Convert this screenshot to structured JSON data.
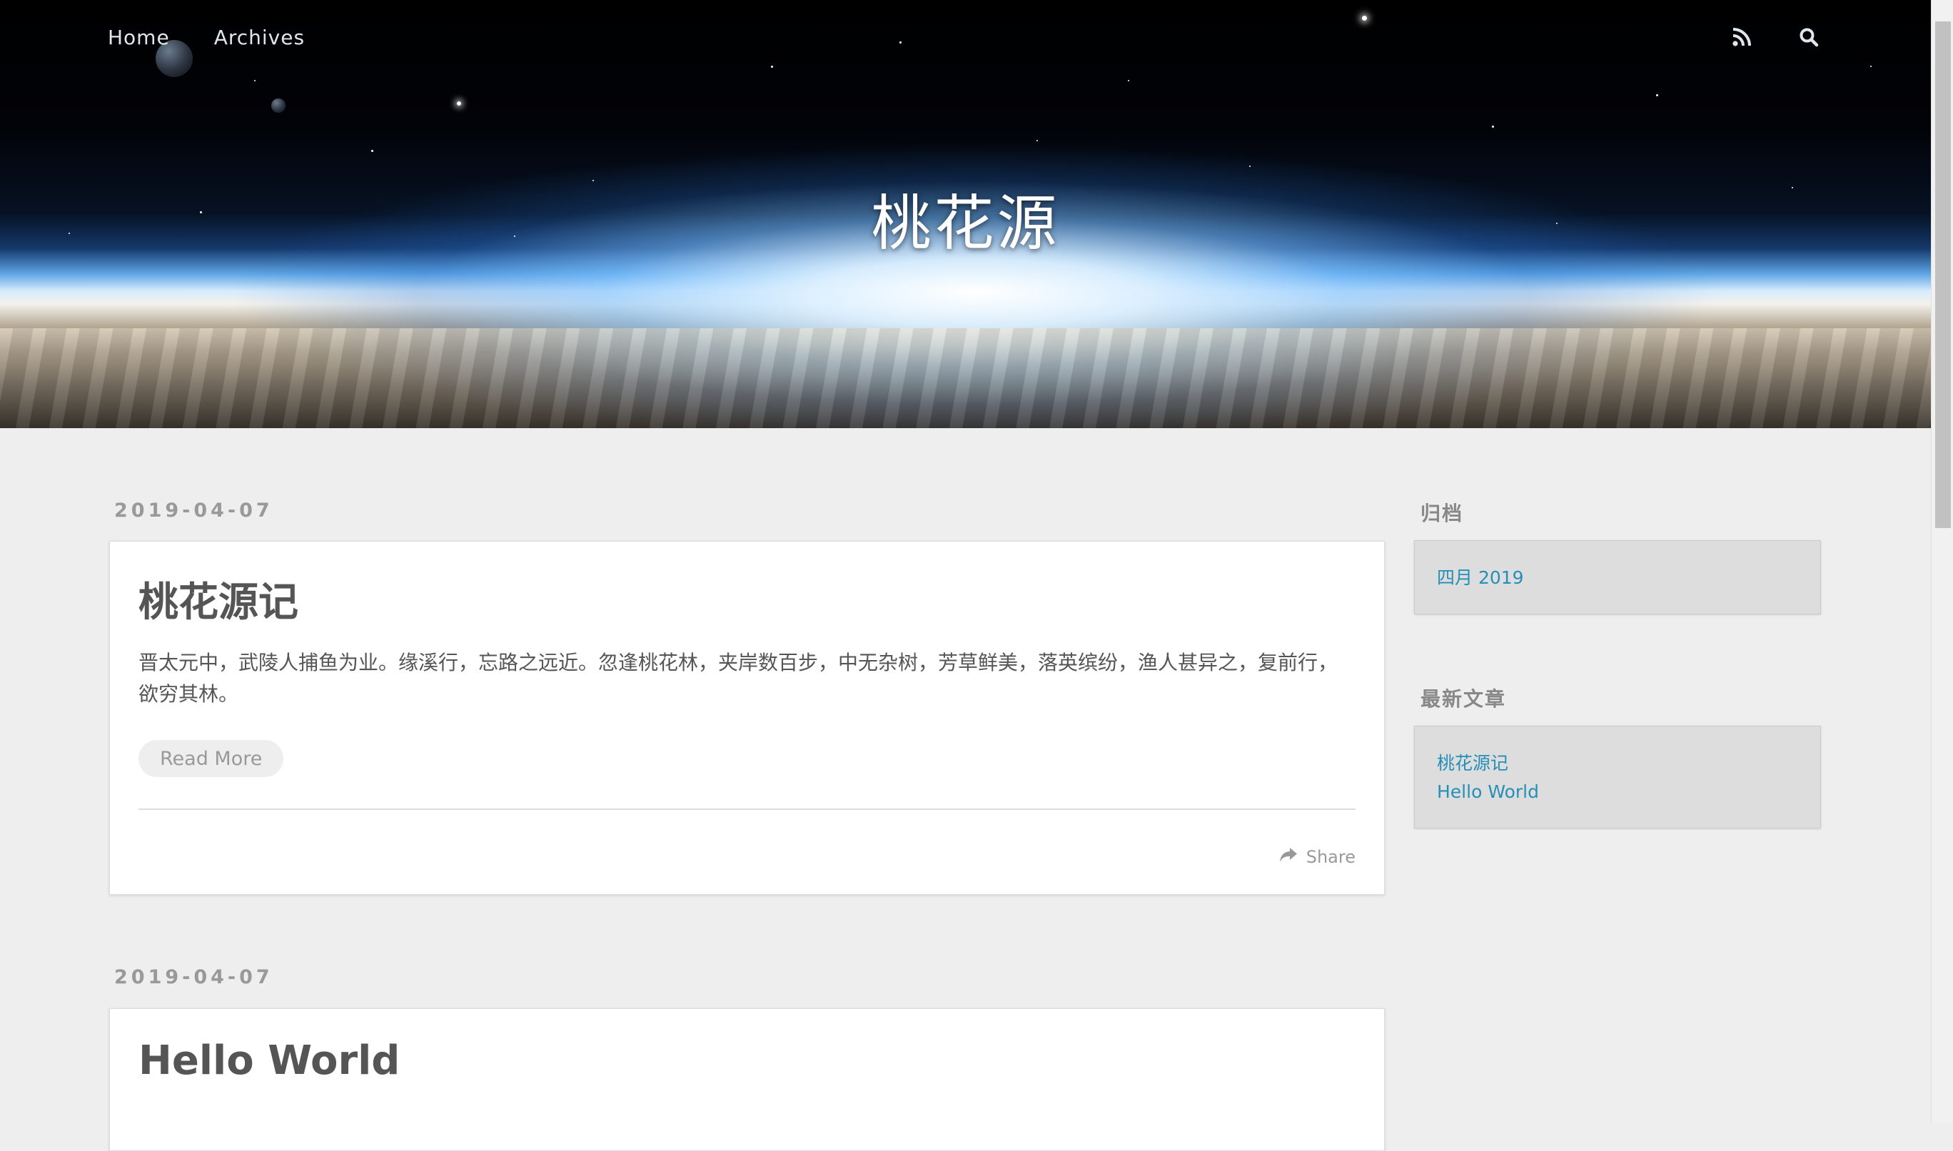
{
  "nav": {
    "links": [
      {
        "label": "Home"
      },
      {
        "label": "Archives"
      }
    ],
    "icons": [
      "rss-icon",
      "search-icon"
    ]
  },
  "site_title": "桃花源",
  "posts": [
    {
      "date": "2019-04-07",
      "title": "桃花源记",
      "excerpt": "晋太元中，武陵人捕鱼为业。缘溪行，忘路之远近。忽逢桃花林，夹岸数百步，中无杂树，芳草鲜美，落英缤纷，渔人甚异之，复前行，欲穷其林。",
      "read_more": "Read More",
      "share": "Share"
    },
    {
      "date": "2019-04-07",
      "title": "Hello World"
    }
  ],
  "sidebar": {
    "archives": {
      "title": "归档",
      "items": [
        "四月 2019"
      ]
    },
    "recent": {
      "title": "最新文章",
      "items": [
        "桃花源记",
        "Hello World"
      ]
    }
  },
  "colors": {
    "background": "#eeeeee",
    "card": "#ffffff",
    "link": "#258fb8",
    "muted": "#999999",
    "text": "#555555",
    "widget": "#dddddd"
  }
}
